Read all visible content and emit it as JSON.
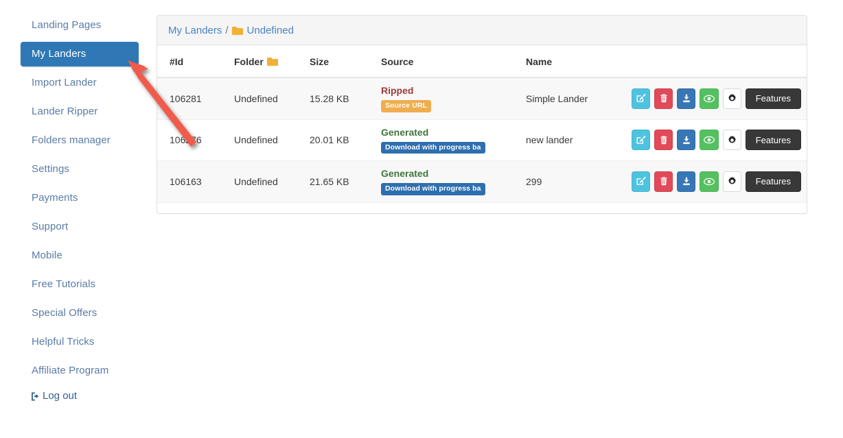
{
  "sidebar": {
    "items": [
      {
        "label": "Landing Pages",
        "active": false
      },
      {
        "label": "My Landers",
        "active": true
      },
      {
        "label": "Import Lander",
        "active": false
      },
      {
        "label": "Lander Ripper",
        "active": false
      },
      {
        "label": "Folders manager",
        "active": false
      },
      {
        "label": "Settings",
        "active": false
      },
      {
        "label": "Payments",
        "active": false
      },
      {
        "label": "Support",
        "active": false
      },
      {
        "label": "Mobile",
        "active": false
      },
      {
        "label": "Free Tutorials",
        "active": false
      },
      {
        "label": "Special Offers",
        "active": false
      },
      {
        "label": "Helpful Tricks",
        "active": false
      },
      {
        "label": "Affiliate Program",
        "active": false
      }
    ],
    "logout_label": "Log out",
    "logout_icon": "sign-out-icon",
    "active_color": "#2f77b5",
    "link_color": "#5a7ba6"
  },
  "panel": {
    "breadcrumb": {
      "root_label": "My Landers",
      "separator": "/",
      "folder_icon": "folder-icon",
      "current_label": "Undefined"
    },
    "table": {
      "headers": {
        "id": "#Id",
        "folder": "Folder",
        "folder_icon": "folder-icon",
        "size": "Size",
        "source": "Source",
        "name": "Name",
        "actions": ""
      },
      "rows": [
        {
          "id": "106281",
          "folder": "Undefined",
          "size": "15.28 KB",
          "source_label": "Ripped",
          "source_type": "ripped",
          "badge_label": "Source URL",
          "badge_style": "warn",
          "name": "Simple Lander",
          "striped": true
        },
        {
          "id": "106276",
          "folder": "Undefined",
          "size": "20.01 KB",
          "source_label": "Generated",
          "source_type": "generated",
          "badge_label": "Download with progress ba",
          "badge_style": "info",
          "name": "new lander",
          "striped": false
        },
        {
          "id": "106163",
          "folder": "Undefined",
          "size": "21.65 KB",
          "source_label": "Generated",
          "source_type": "generated",
          "badge_label": "Download with progress ba",
          "badge_style": "info",
          "name": "299",
          "striped": true
        }
      ],
      "actions": {
        "edit_icon": "edit-pencil-square-icon",
        "delete_icon": "trash-icon",
        "download_icon": "download-icon",
        "preview_icon": "eye-icon",
        "settings_icon": "gear-icon",
        "features_label": "Features"
      }
    }
  },
  "annotation": {
    "arrow_icon": "red-arrow-pointer",
    "color": "#ef5b4c"
  }
}
